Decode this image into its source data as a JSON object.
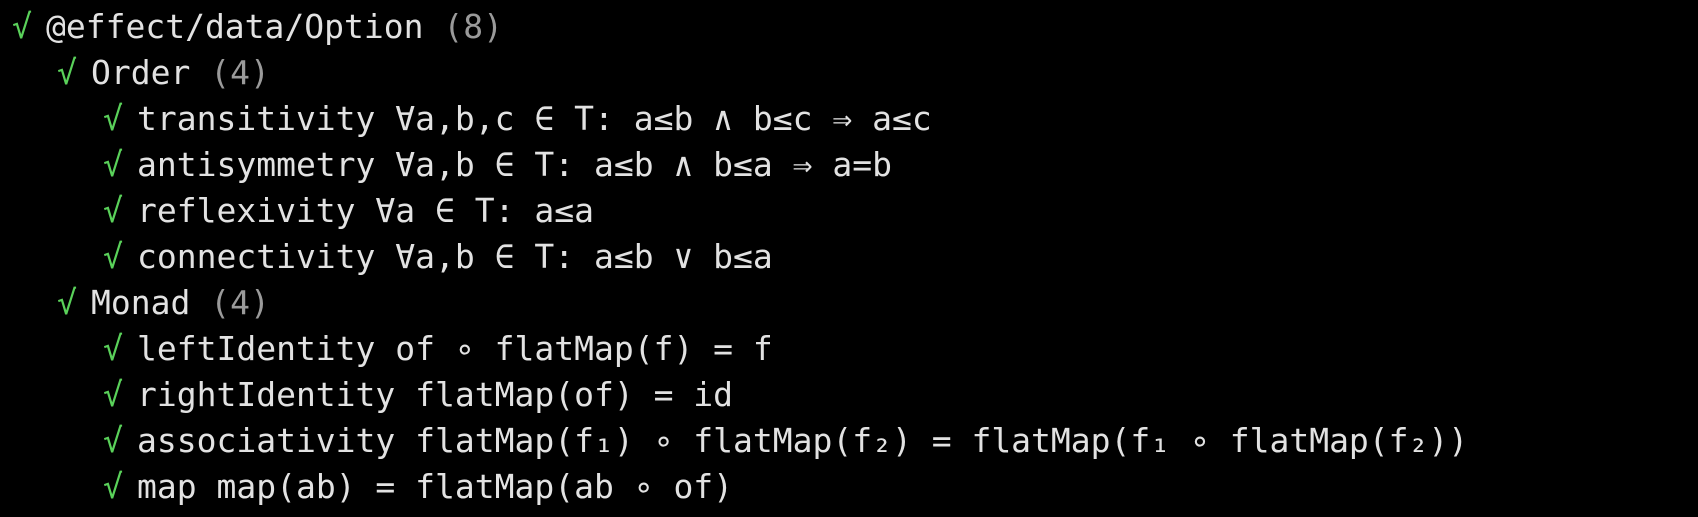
{
  "colors": {
    "background": "#000000",
    "pass": "#5ad15a",
    "text": "#e2e2e2",
    "count": "#9a9a9a"
  },
  "icons": {
    "pass": "check-icon"
  },
  "suite": {
    "check": "√",
    "name": "@effect/data/Option",
    "count": "(8)",
    "groups": [
      {
        "check": "√",
        "name": "Order",
        "count": "(4)",
        "tests": [
          {
            "check": "√",
            "name": "transitivity",
            "formula": "∀a,b,c ∈ T: a≤b ∧ b≤c ⇒ a≤c"
          },
          {
            "check": "√",
            "name": "antisymmetry",
            "formula": "∀a,b ∈ T: a≤b ∧ b≤a ⇒ a=b"
          },
          {
            "check": "√",
            "name": "reflexivity",
            "formula": "∀a ∈ T: a≤a"
          },
          {
            "check": "√",
            "name": "connectivity",
            "formula": "∀a,b ∈ T: a≤b ∨ b≤a"
          }
        ]
      },
      {
        "check": "√",
        "name": "Monad",
        "count": "(4)",
        "tests": [
          {
            "check": "√",
            "name": "leftIdentity",
            "formula": "of ∘ flatMap(f) = f"
          },
          {
            "check": "√",
            "name": "rightIdentity",
            "formula": "flatMap(of) = id"
          },
          {
            "check": "√",
            "name": "associativity",
            "formula": "flatMap(f₁) ∘ flatMap(f₂) = flatMap(f₁ ∘ flatMap(f₂))"
          },
          {
            "check": "√",
            "name": "map",
            "formula": "map(ab) = flatMap(ab ∘ of)"
          }
        ]
      }
    ]
  }
}
